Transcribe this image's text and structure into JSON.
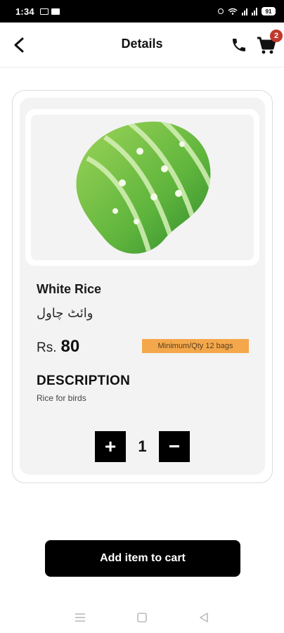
{
  "status_bar": {
    "time": "1:34",
    "battery": "91"
  },
  "header": {
    "title": "Details",
    "cart_count": "2"
  },
  "product": {
    "name": "White Rice",
    "name_urdu": "وائٹ چاول",
    "price_currency": "Rs.",
    "price_value": "80",
    "min_qty": "Minimum/Qty 12 bags",
    "description_heading": "DESCRIPTION",
    "description": "Rice for birds",
    "quantity": "1",
    "increment_label": "+",
    "decrement_label": "−"
  },
  "actions": {
    "add_to_cart": "Add item to cart"
  },
  "colors": {
    "accent_badge": "#f4a84b",
    "cart_badge": "#c0392b",
    "primary_button": "#000000"
  },
  "icons": {
    "back": "chevron-left-icon",
    "phone": "phone-icon",
    "cart": "cart-icon",
    "nav_recents": "menu-icon",
    "nav_home": "square-icon",
    "nav_back": "triangle-back-icon"
  }
}
